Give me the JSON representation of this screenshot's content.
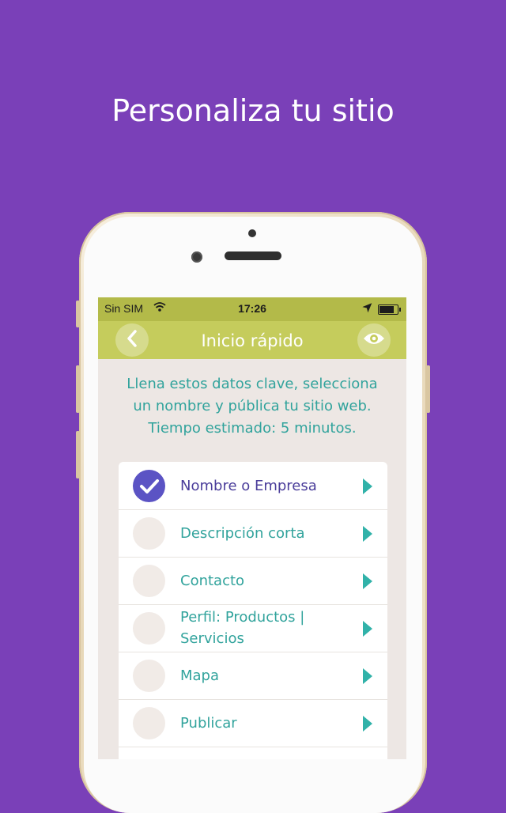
{
  "headline": "Personaliza tu sitio",
  "status_bar": {
    "carrier": "Sin SIM",
    "time": "17:26",
    "battery_level": 0.9
  },
  "nav": {
    "title": "Inicio rápido",
    "back_icon": "chevron-left-icon",
    "preview_icon": "eye-icon"
  },
  "intro_lines": [
    "Llena estos datos clave, selecciona",
    "un nombre y pública tu sitio web.",
    "Tiempo estimado:  5 minutos."
  ],
  "steps": [
    {
      "label": "Nombre o Empresa",
      "done": true
    },
    {
      "label": "Descripción corta",
      "done": false
    },
    {
      "label": "Contacto",
      "done": false
    },
    {
      "label": "Perfil: Productos | Servicios",
      "done": false
    },
    {
      "label": "Mapa",
      "done": false
    },
    {
      "label": "Publicar",
      "done": false
    }
  ],
  "colors": {
    "background": "#7a40b8",
    "nav_bar": "#c5cc5c",
    "status_bar": "#b3ba49",
    "accent_teal": "#31a39c",
    "check_done": "#5b53c4"
  }
}
